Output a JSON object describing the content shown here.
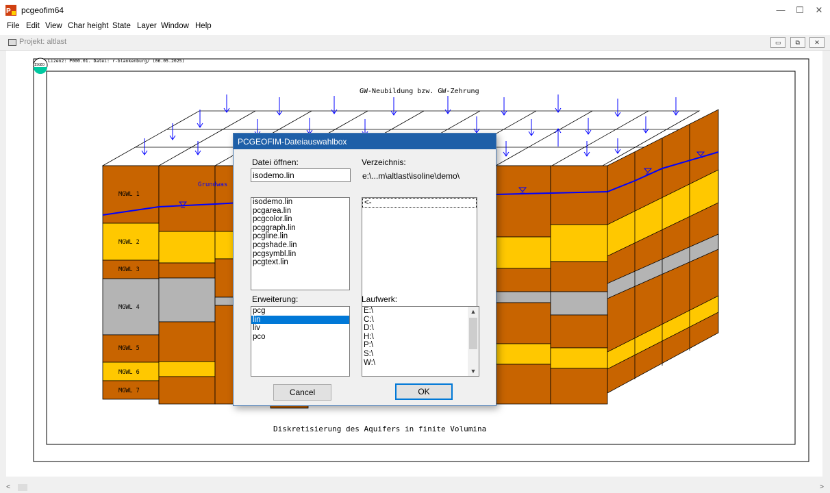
{
  "window": {
    "title": "pcgeofim64",
    "controls": {
      "minimize": "—",
      "maximize": "☐",
      "close": "✕"
    }
  },
  "menu": [
    "File",
    "Edit",
    "View",
    "Char height",
    "State",
    "Layer",
    "Window",
    "Help"
  ],
  "mdi": {
    "title": "Projekt: altlast",
    "controls": [
      "▭",
      "⧉",
      "✕"
    ]
  },
  "drawing": {
    "license": "Lizenz: P000.01. Datei: r-blankenburg/ (06.05.2025)",
    "logo_text": "ISGEO",
    "top_caption": "GW-Neubildung bzw. GW-Zehrung",
    "bottom_caption": "Diskretisierung des Aquifers in finite Volumina",
    "partial_label": "Grundwas",
    "layers": [
      "MGWL 1",
      "MGWL 2",
      "MGWL 3",
      "MGWL 4",
      "MGWL 5",
      "MGWL 6",
      "MGWL 7"
    ],
    "colors": {
      "brown": "#c86400",
      "yellow": "#ffc800",
      "gray": "#b4b4b4",
      "water_line": "#0000ff",
      "dialog_title": "#1e5fa8",
      "selection": "#0078d7"
    }
  },
  "dialog": {
    "title": "PCGEOFIM-Dateiauswahlbox",
    "open_label": "Datei öffnen:",
    "filename": "isodemo.lin",
    "dir_label": "Verzeichnis:",
    "dir_path": "e:\\...m\\altlast\\isoline\\demo\\",
    "files": [
      "isodemo.lin",
      "pcgarea.lin",
      "pcgcolor.lin",
      "pcggraph.lin",
      "pcgline.lin",
      "pcgshade.lin",
      "pcgsymbl.lin",
      "pcgtext.lin"
    ],
    "dirs": [
      "<-"
    ],
    "ext_label": "Erweiterung:",
    "extensions": [
      "pcg",
      "lin",
      "liv",
      "pco"
    ],
    "selected_extension": "lin",
    "drive_label": "Laufwerk:",
    "drives": [
      "E:\\",
      "C:\\",
      "D:\\",
      "H:\\",
      "P:\\",
      "S:\\",
      "W:\\"
    ],
    "cancel": "Cancel",
    "ok": "OK"
  }
}
